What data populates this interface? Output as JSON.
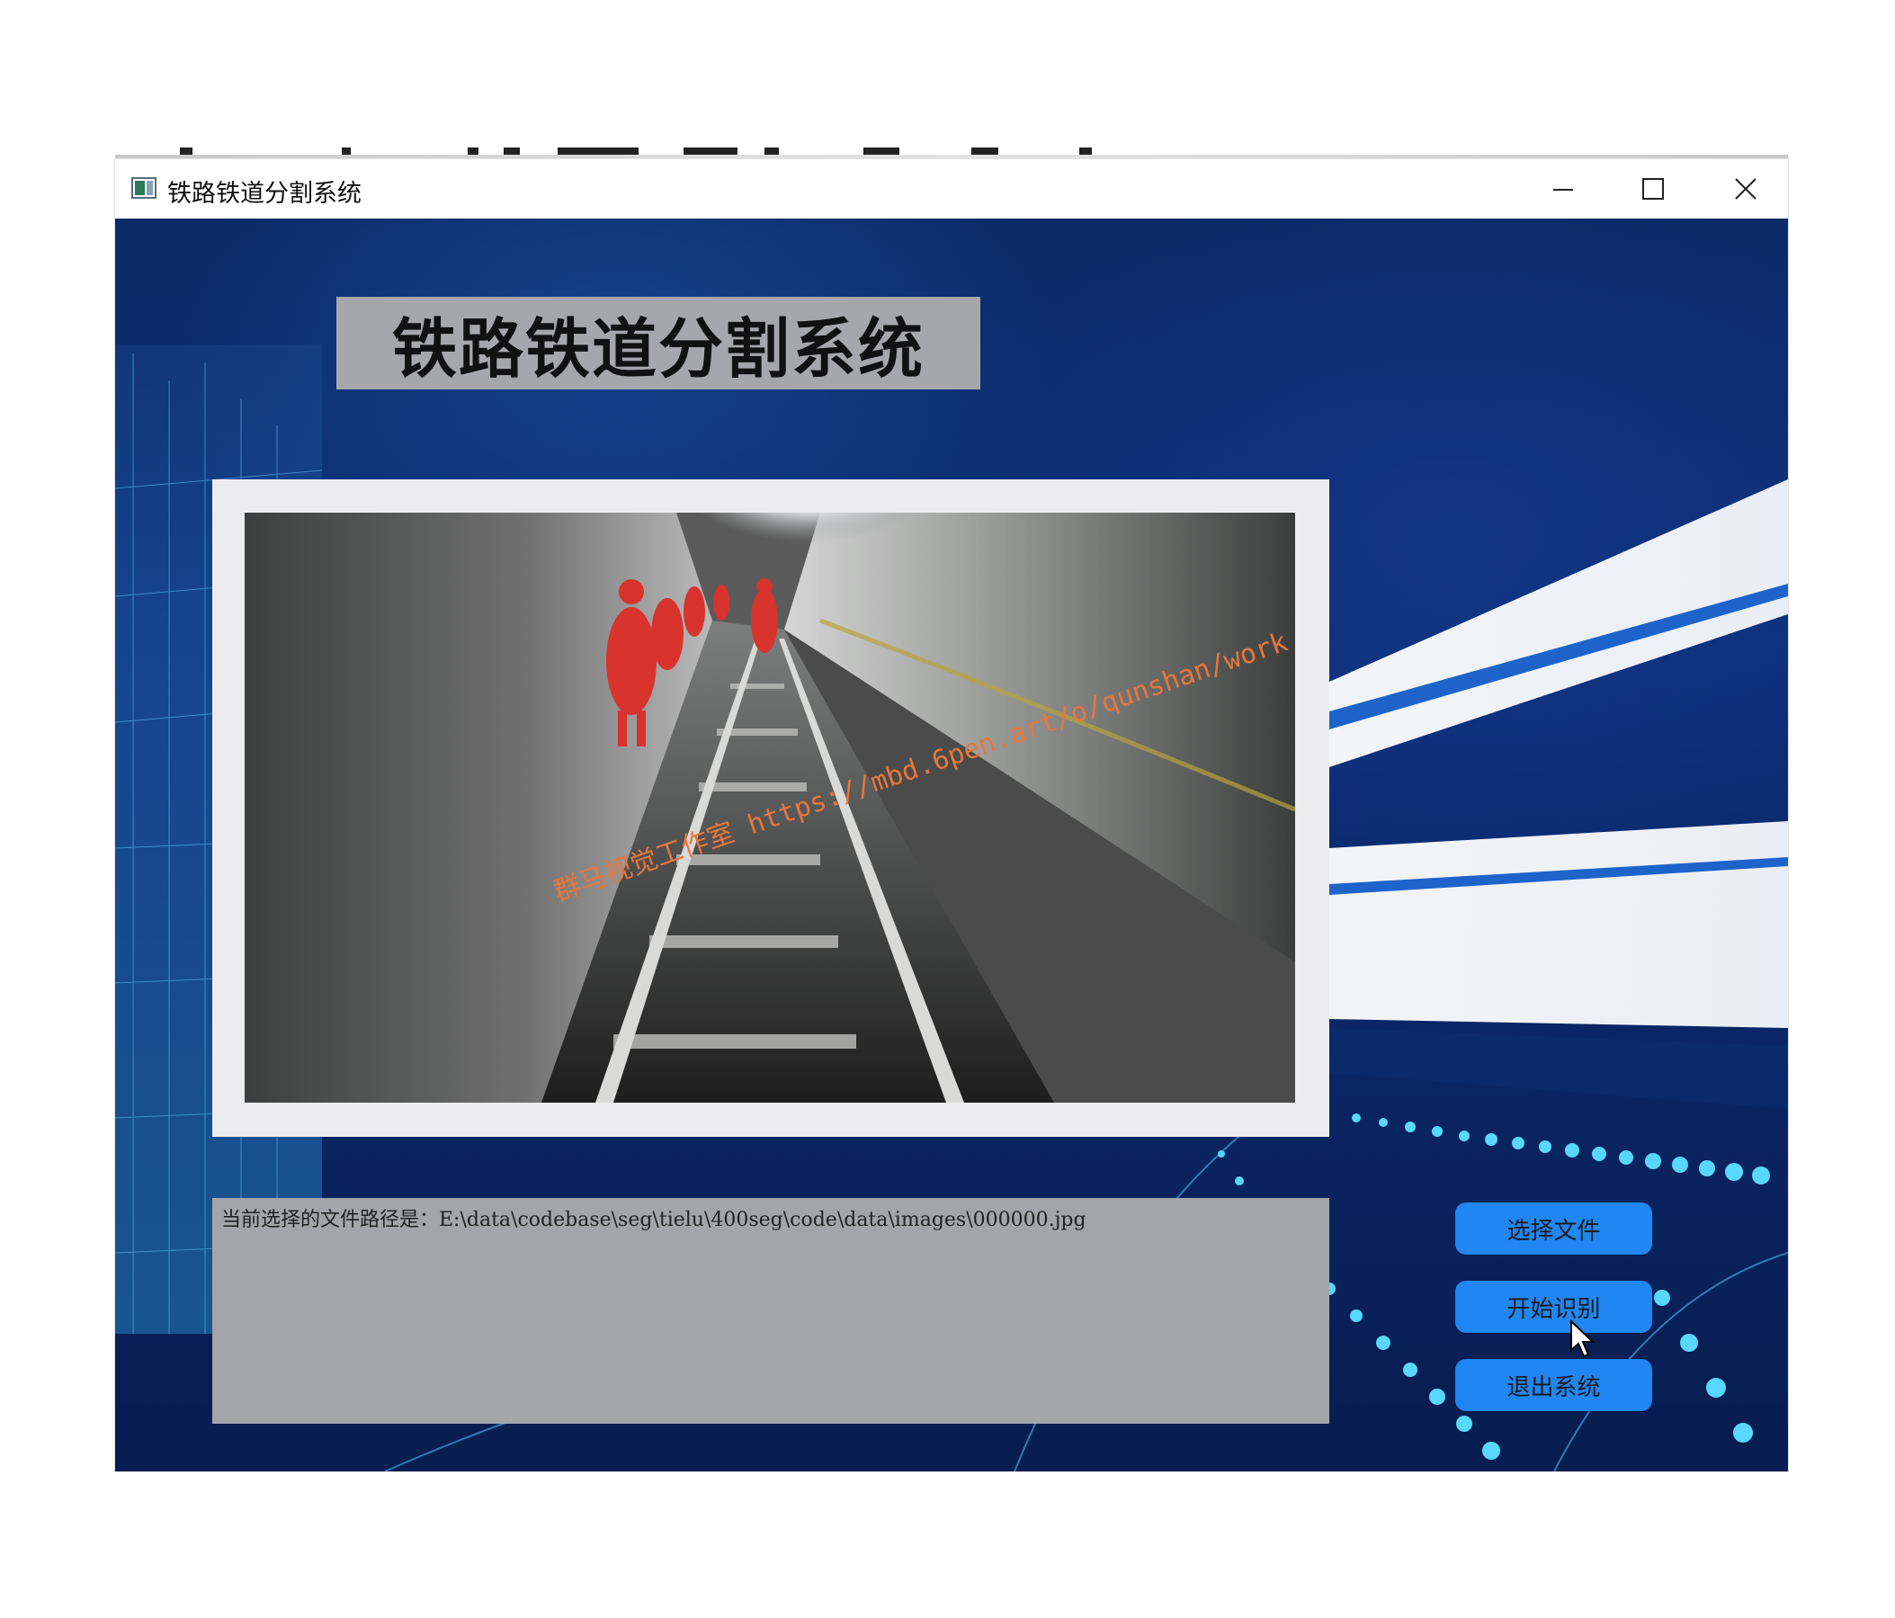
{
  "window": {
    "title": "铁路铁道分割系统",
    "controls": {
      "minimize_icon": "minimize-icon",
      "maximize_icon": "maximize-icon",
      "close_icon": "close-icon"
    }
  },
  "header": {
    "title": "铁路铁道分割系统"
  },
  "image_panel": {
    "watermark": "群马视觉工作室 https://mbd.6pen.art/o/qunshan/work"
  },
  "log": {
    "text": "当前选择的文件路径是：E:\\data\\codebase\\seg\\tielu\\400seg\\code\\data\\images\\000000.jpg"
  },
  "buttons": {
    "select_file": "选择文件",
    "start_recognition": "开始识别",
    "exit_system": "退出系统"
  },
  "colors": {
    "button_blue": "#1f86f2",
    "panel_gray": "#a4a5aa",
    "background_navy": "#0c2f78",
    "watermark_orange": "#e8763a"
  }
}
